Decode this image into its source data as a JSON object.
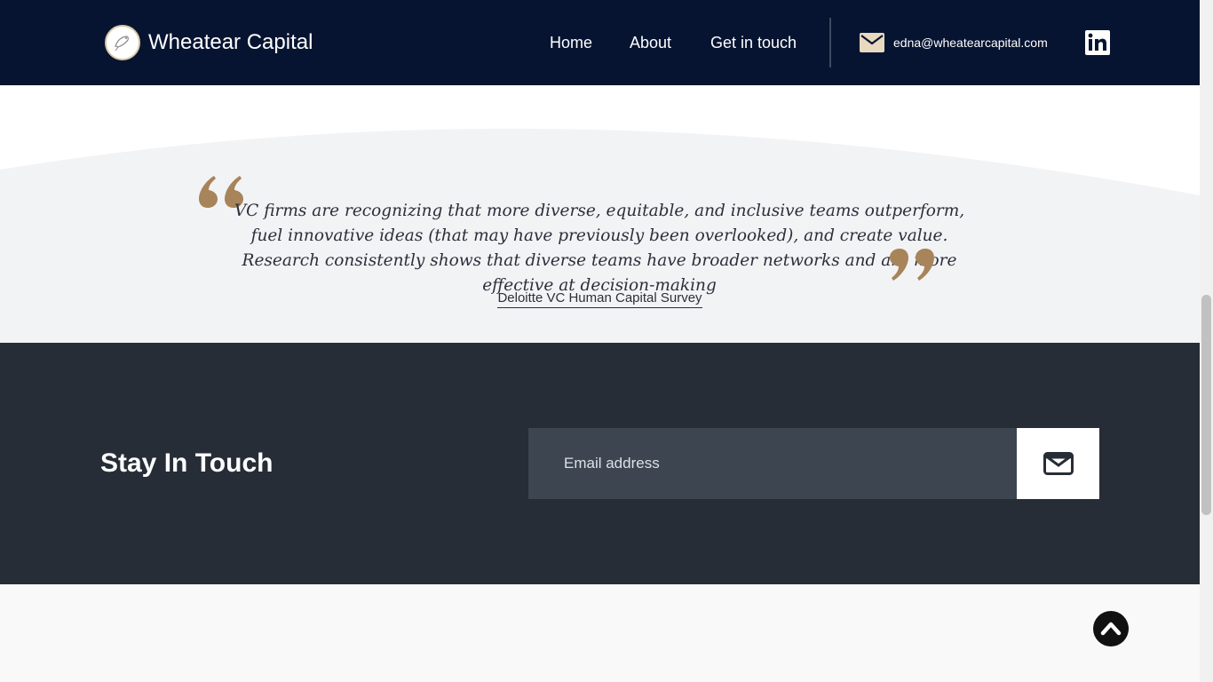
{
  "header": {
    "brand": "Wheatear Capital",
    "logo_icon": "bird-logo-icon",
    "nav": [
      {
        "label": "Home"
      },
      {
        "label": "About"
      },
      {
        "label": "Get in touch"
      }
    ],
    "email": "edna@wheatearcapital.com",
    "mail_icon": "mail-icon",
    "social_icon": "linkedin-icon",
    "background_color": "#061431"
  },
  "quote": {
    "text": "VC firms are recognizing that more diverse, equitable, and inclusive teams outperform, fuel innovative ideas (that may have previously been overlooked), and create value. Research consistently shows that diverse teams have broader networks and are more effective at decision-making",
    "source": "Deloitte VC Human Capital Survey",
    "accent_color": "#a8845a"
  },
  "newsletter": {
    "title": "Stay In Touch",
    "email_placeholder": "Email address",
    "email_value": "",
    "submit_icon": "envelope-icon",
    "background_color": "#262d36"
  },
  "footer": {
    "back_to_top_icon": "chevron-up-icon"
  }
}
